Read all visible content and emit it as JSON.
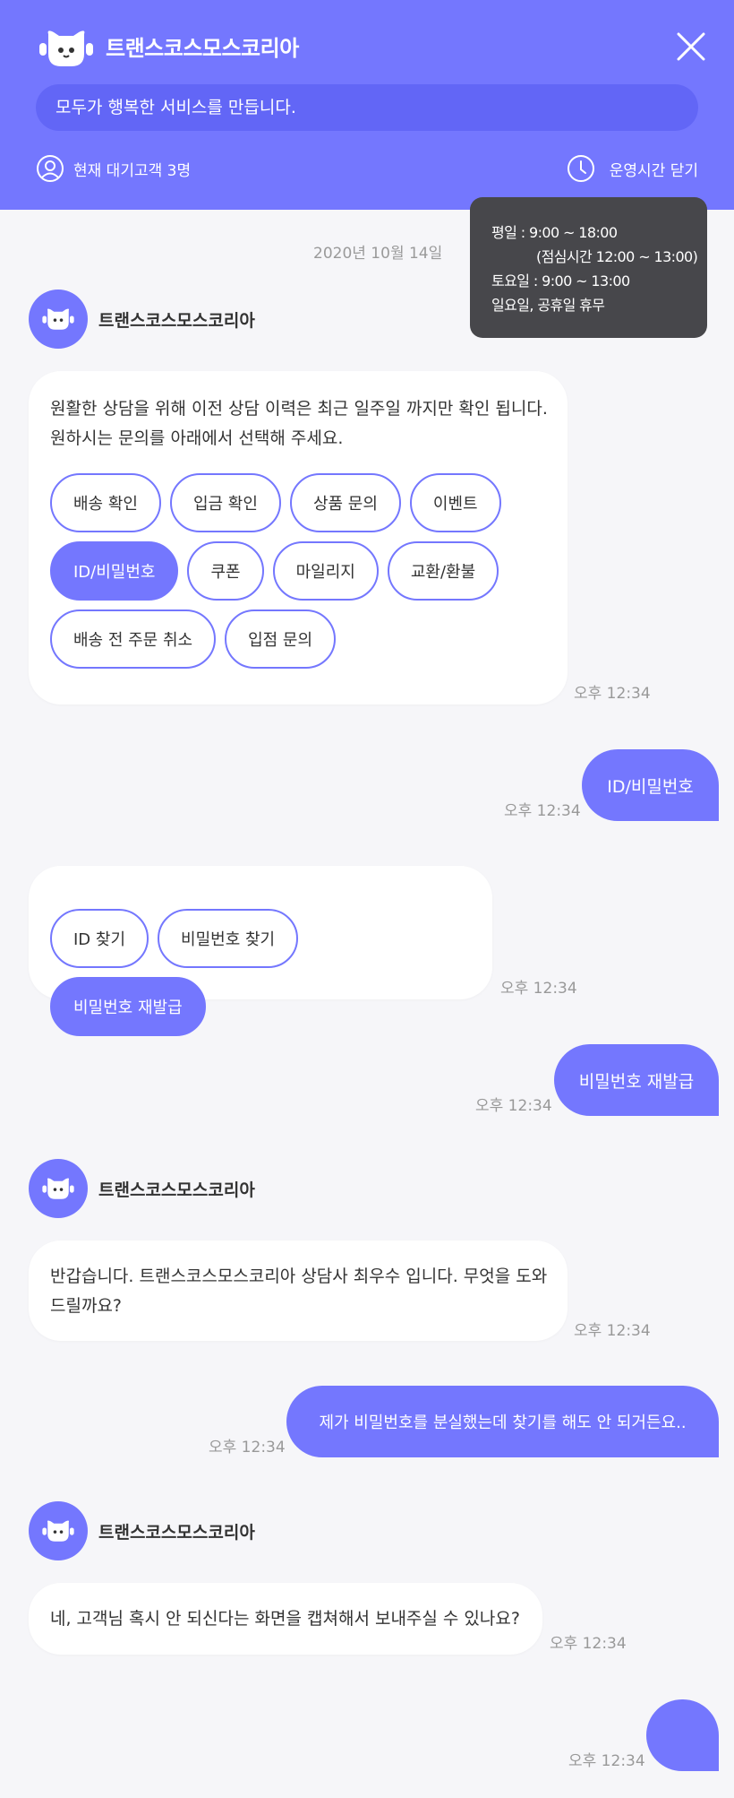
{
  "header": {
    "brand": "트랜스코스모스코리아",
    "slogan": "모두가 행복한 서비스를 만듭니다.",
    "wait_text": "현재 대기고객 3명",
    "hours_toggle": "운영시간 닫기",
    "accent": "#7477fe"
  },
  "hours_popup": {
    "line1": "평일 : 9:00 ~ 18:00",
    "line2": "(점심시간 12:00 ~ 13:00)",
    "line3": "토요일 : 9:00 ~ 13:00",
    "line4": "일요일, 공휴일 휴무"
  },
  "date": "2020년 10월 14일",
  "bot_name": "트랜스코스모스코리아",
  "messages": {
    "m1": {
      "text": "원활한 상담을 위해 이전 상담 이력은 최근 일주일 까지만 확인 됩니다. 원하시는 문의를 아래에서 선택해 주세요.",
      "chips": [
        "배송 확인",
        "입금 확인",
        "상품 문의",
        "이벤트",
        "ID/비밀번호",
        "쿠폰",
        "마일리지",
        "교환/환불",
        "배송 전 주문 취소",
        "입점 문의"
      ],
      "time": "오후 12:34"
    },
    "u1": {
      "text": "ID/비밀번호",
      "time": "오후 12:34"
    },
    "m2": {
      "chips": [
        "ID 찾기",
        "비밀번호 찾기",
        "비밀번호 재발급"
      ],
      "time": "오후 12:34"
    },
    "u2": {
      "text": "비밀번호 재발급",
      "time": "오후 12:34"
    },
    "m3": {
      "text": "반갑습니다. 트랜스코스모스코리아 상담사 최우수 입니다. 무엇을 도와 드릴까요?",
      "time": "오후 12:34"
    },
    "u3": {
      "text": "제가 비밀번호를 분실했는데 찾기를 해도 안 되거든요..",
      "time": "오후 12:34"
    },
    "m4": {
      "text": "네, 고객님 혹시 안 되신다는 화면을 캡쳐해서 보내주실 수 있나요?",
      "time": "오후 12:34"
    },
    "u4": {
      "time": "오후 12:34"
    }
  }
}
